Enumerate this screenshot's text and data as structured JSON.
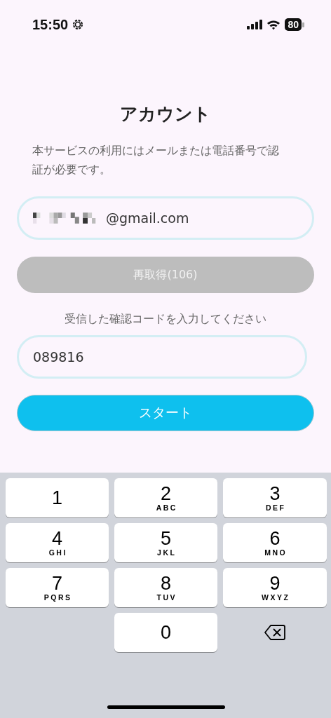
{
  "status_bar": {
    "time": "15:50",
    "battery": "80"
  },
  "title": "アカウント",
  "description": "本サービスの利用にはメールまたは電話番号で認証が必要です。",
  "email_field": {
    "value": "@gmail.com",
    "redacted": true
  },
  "resend_button": {
    "label": "再取得(106)",
    "disabled": true
  },
  "code_label": "受信した確認コードを入力してください",
  "code_field": {
    "value": "089816"
  },
  "start_button": {
    "label": "スタート"
  },
  "keypad": [
    {
      "kind": "key",
      "digit": "1"
    },
    {
      "kind": "key",
      "digit": "2",
      "letters": "ABC"
    },
    {
      "kind": "key",
      "digit": "3",
      "letters": "DEF"
    },
    {
      "kind": "key",
      "digit": "4",
      "letters": "GHI"
    },
    {
      "kind": "key",
      "digit": "5",
      "letters": "JKL"
    },
    {
      "kind": "key",
      "digit": "6",
      "letters": "MNO"
    },
    {
      "kind": "key",
      "digit": "7",
      "letters": "PQRS"
    },
    {
      "kind": "key",
      "digit": "8",
      "letters": "TUV"
    },
    {
      "kind": "key",
      "digit": "9",
      "letters": "WXYZ"
    },
    {
      "kind": "blank"
    },
    {
      "kind": "key",
      "digit": "0"
    },
    {
      "kind": "delete"
    }
  ]
}
